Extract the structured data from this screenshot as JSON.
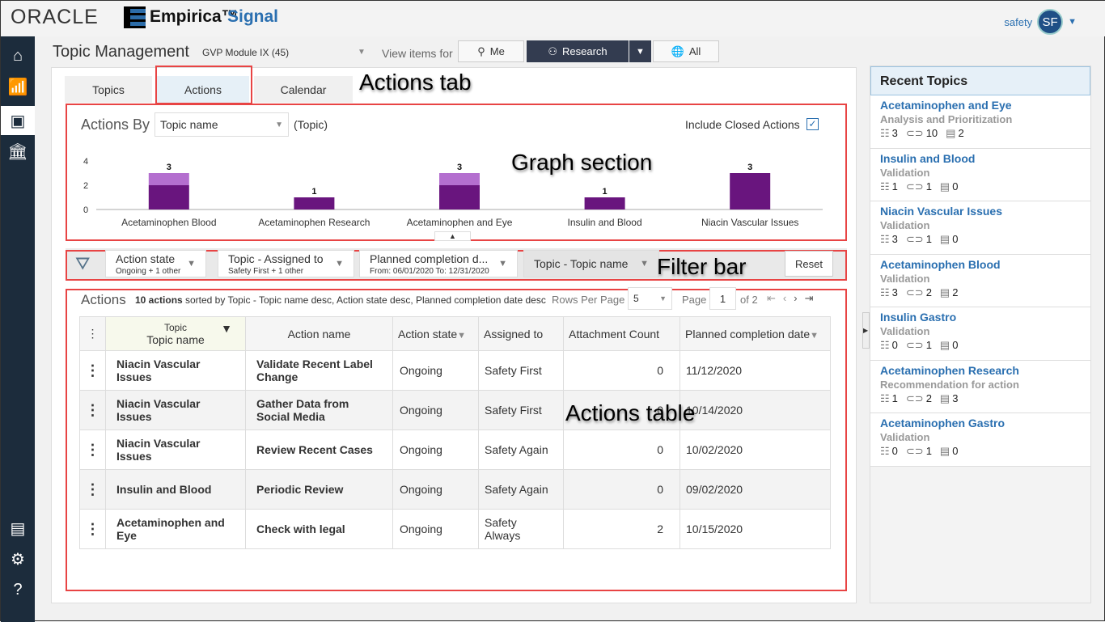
{
  "header": {
    "brand_oracle": "ORACLE",
    "brand_empirica": "Empirica™",
    "brand_signal": "Signal",
    "user_name": "safety",
    "user_initials": "SF"
  },
  "sidebar": {
    "items": [
      {
        "icon": "home-icon"
      },
      {
        "icon": "signal-icon"
      },
      {
        "icon": "topics-icon",
        "active": true
      },
      {
        "icon": "reports-icon"
      },
      {
        "icon": "comments-icon"
      },
      {
        "icon": "settings-icon"
      },
      {
        "icon": "help-icon"
      }
    ]
  },
  "page": {
    "title": "Topic Management",
    "module": "GVP Module IX (45)",
    "view_items_for": "View items for",
    "view_buttons": {
      "me": "Me",
      "research": "Research",
      "all": "All"
    }
  },
  "tabs": [
    {
      "label": "Topics"
    },
    {
      "label": "Actions",
      "active": true
    },
    {
      "label": "Calendar"
    }
  ],
  "annotations": {
    "actions_tab": "Actions tab",
    "graph_section": "Graph section",
    "filter_bar": "Filter bar",
    "actions_table": "Actions table"
  },
  "graph": {
    "actions_by": "Actions By",
    "group_select": "Topic name",
    "group_suffix": "(Topic)",
    "include_closed": "Include Closed Actions",
    "include_closed_checked": true
  },
  "chart_data": {
    "type": "bar",
    "stacked": true,
    "categories": [
      "Acetaminophen Blood",
      "Acetaminophen Research",
      "Acetaminophen and Eye",
      "Insulin and Blood",
      "Niacin Vascular Issues"
    ],
    "series": [
      {
        "values": [
          2,
          1,
          2,
          1,
          3
        ],
        "color": "#69157e"
      },
      {
        "values": [
          1,
          0,
          1,
          0,
          0
        ],
        "color": "#b46fcf"
      }
    ],
    "totals": [
      "3",
      "1",
      "3",
      "1",
      "3"
    ],
    "ylim": [
      0,
      4
    ],
    "yticks": [
      "0",
      "2",
      "4"
    ]
  },
  "filters": [
    {
      "title": "Action state",
      "sub": "Ongoing + 1 other"
    },
    {
      "title": "Topic - Assigned to",
      "sub": "Safety First + 1 other"
    },
    {
      "title": "Planned completion d...",
      "sub": "From: 06/01/2020 To: 12/31/2020"
    },
    {
      "title": "Topic - Topic name",
      "sub": ""
    }
  ],
  "reset": "Reset",
  "actions": {
    "title": "Actions",
    "summary": "10 actions",
    "sorted": "sorted by Topic - Topic name desc, Action state desc, Planned completion date desc",
    "rows_per_page_label": "Rows Per Page",
    "rows_per_page": "5",
    "page_label": "Page",
    "page": "1",
    "of_pages": "of 2",
    "columns": {
      "topic_group": "Topic",
      "topic": "Topic name",
      "action": "Action name",
      "state": "Action state",
      "assigned": "Assigned to",
      "attach": "Attachment Count",
      "date": "Planned completion date"
    },
    "rows": [
      {
        "topic": "Niacin Vascular Issues",
        "action": "Validate Recent Label Change",
        "state": "Ongoing",
        "assigned": "Safety First",
        "attach": "0",
        "date": "11/12/2020"
      },
      {
        "topic": "Niacin Vascular Issues",
        "action": "Gather Data from Social Media",
        "state": "Ongoing",
        "assigned": "Safety First",
        "attach": "0",
        "date": "10/14/2020"
      },
      {
        "topic": "Niacin Vascular Issues",
        "action": "Review Recent Cases",
        "state": "Ongoing",
        "assigned": "Safety Again",
        "attach": "0",
        "date": "10/02/2020"
      },
      {
        "topic": "Insulin and Blood",
        "action": "Periodic Review",
        "state": "Ongoing",
        "assigned": "Safety Again",
        "attach": "0",
        "date": "09/02/2020"
      },
      {
        "topic": "Acetaminophen and Eye",
        "action": "Check with legal",
        "state": "Ongoing",
        "assigned": "Safety Always",
        "attach": "2",
        "date": "10/15/2020"
      }
    ]
  },
  "recent": {
    "title": "Recent Topics",
    "items": [
      {
        "title": "Acetaminophen and Eye",
        "state": "Analysis and Prioritization",
        "actions": "3",
        "attachments": "10",
        "comments": "2"
      },
      {
        "title": "Insulin and Blood",
        "state": "Validation",
        "actions": "1",
        "attachments": "1",
        "comments": "0"
      },
      {
        "title": "Niacin Vascular Issues",
        "state": "Validation",
        "actions": "3",
        "attachments": "1",
        "comments": "0"
      },
      {
        "title": "Acetaminophen Blood",
        "state": "Validation",
        "actions": "3",
        "attachments": "2",
        "comments": "2"
      },
      {
        "title": "Insulin Gastro",
        "state": "Validation",
        "actions": "0",
        "attachments": "1",
        "comments": "0"
      },
      {
        "title": "Acetaminophen Research",
        "state": "Recommendation for action",
        "actions": "1",
        "attachments": "2",
        "comments": "3"
      },
      {
        "title": "Acetaminophen Gastro",
        "state": "Validation",
        "actions": "0",
        "attachments": "1",
        "comments": "0"
      }
    ]
  }
}
